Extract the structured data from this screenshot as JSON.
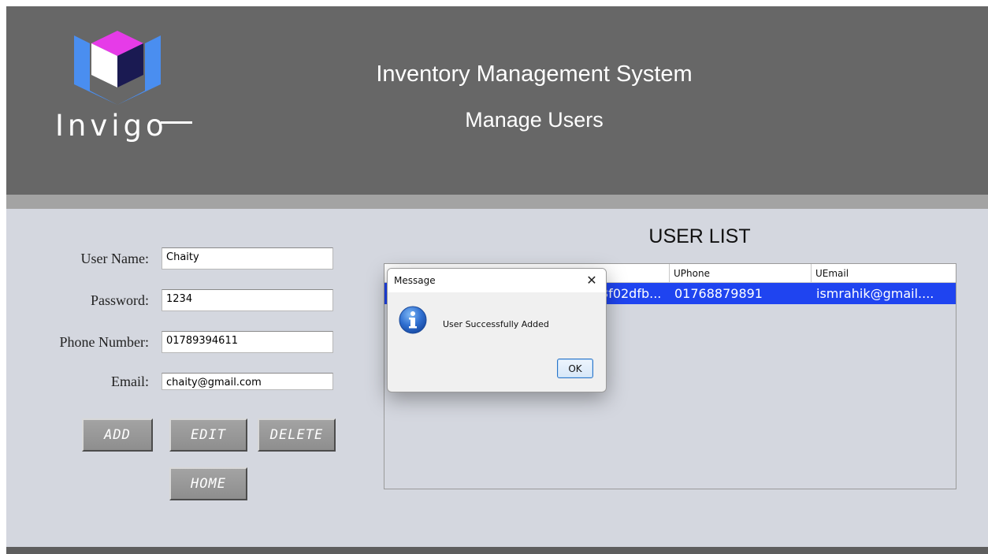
{
  "header": {
    "logo_text": "Invigo",
    "title": "Inventory Management System",
    "subtitle": "Manage Users"
  },
  "form": {
    "fields": [
      {
        "label": "User Name:",
        "value": "Chaity"
      },
      {
        "label": "Password:",
        "value": "1234"
      },
      {
        "label": "Phone Number:",
        "value": "01789394611"
      },
      {
        "label": "Email:",
        "value": "chaity@gmail.com"
      }
    ],
    "buttons": {
      "add": "ADD",
      "edit": "EDIT",
      "delete": "DELETE",
      "home": "HOME"
    }
  },
  "user_list": {
    "title": "USER LIST",
    "columns": [
      "UPhone",
      "UEmail"
    ],
    "rows": [
      {
        "partial": "3f02dfb...",
        "phone": "01768879891",
        "email": "ismrahik@gmail...."
      }
    ]
  },
  "dialog": {
    "title": "Message",
    "icon": "info-icon",
    "message": "User Successfully Added",
    "ok_label": "OK"
  },
  "colors": {
    "header_bg": "#676767",
    "body_bg": "#d4d7df",
    "selection": "#1f44f0",
    "logo_blue": "#4a8ef0",
    "logo_magenta": "#e63be8",
    "logo_navy": "#1a1a52"
  }
}
